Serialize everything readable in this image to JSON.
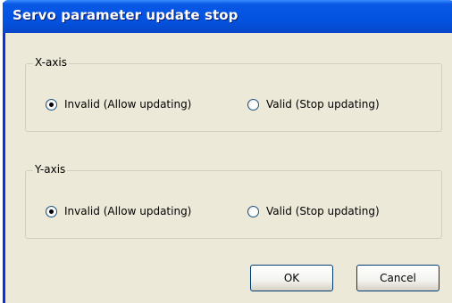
{
  "window": {
    "title": "Servo parameter update stop"
  },
  "x_axis": {
    "legend": "X-axis",
    "option_invalid": "Invalid (Allow updating)",
    "option_valid": "Valid (Stop updating)",
    "selected": "invalid"
  },
  "y_axis": {
    "legend": "Y-axis",
    "option_invalid": "Invalid (Allow updating)",
    "option_valid": "Valid (Stop updating)",
    "selected": "invalid"
  },
  "buttons": {
    "ok_label": "OK",
    "cancel_label": "Cancel"
  },
  "colors": {
    "titlebar": "#0554e3",
    "dialog_face": "#ece9d8",
    "groupbox_border": "#d0d0bf",
    "button_border": "#003c74"
  }
}
